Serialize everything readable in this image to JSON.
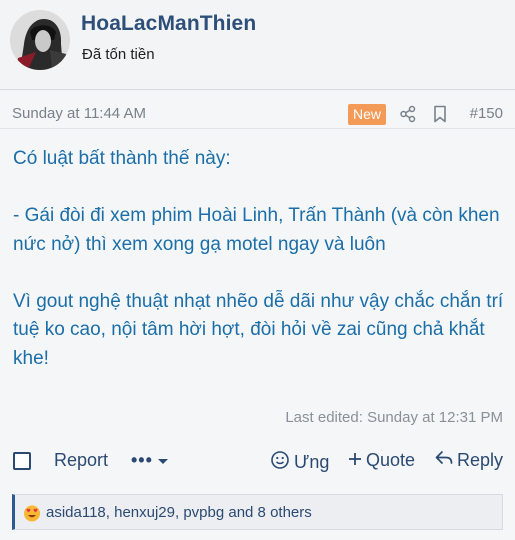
{
  "user": {
    "name": "HoaLacManThien",
    "title": "Đã tốn tiền"
  },
  "post": {
    "date": "Sunday at 11:44 AM",
    "badge": "New",
    "number": "#150",
    "lines": [
      "Có luật bất thành thế này:",
      "",
      "- Gái đòi đi xem phim Hoài Linh, Trấn Thành (và còn khen nức nở) thì xem xong gạ motel ngay và luôn",
      "",
      "Vì gout nghệ thuật nhạt nhẽo dễ dãi như vậy chắc chắn trí tuệ ko cao, nội tâm hời hợt, đòi hỏi về zai cũng chả khắt khe!"
    ],
    "last_edited": "Last edited: Sunday at 12:31 PM"
  },
  "actions": {
    "report": "Report",
    "more": "•••",
    "react": "Ưng",
    "quote": "Quote",
    "reply": "Reply"
  },
  "reactions": {
    "summary": "asida118, henxuj29, pvpbg and 8 others",
    "emoji": "heart-eyes-emoji"
  },
  "colors": {
    "accent": "#2b4a72",
    "message": "#1b6ea8",
    "badge": "#f39a56"
  }
}
